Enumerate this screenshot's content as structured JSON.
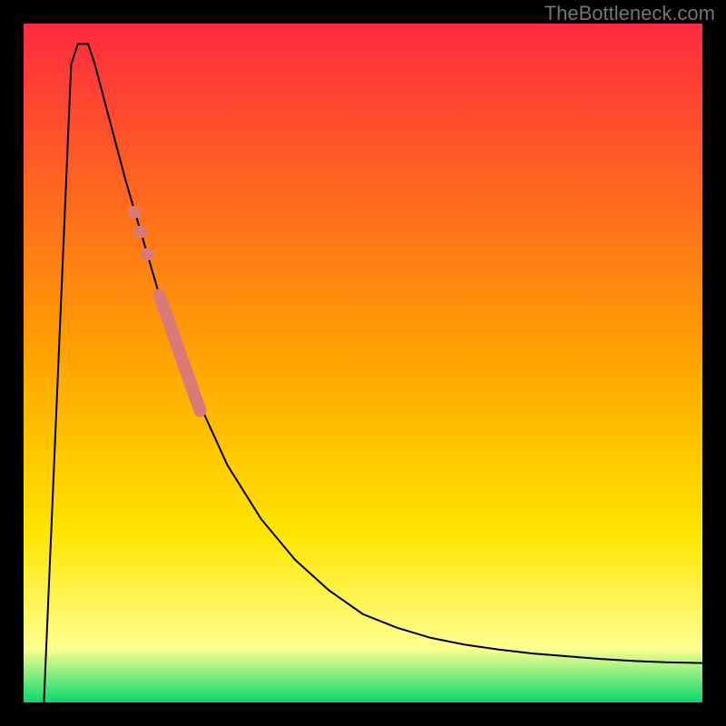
{
  "watermark": "TheBottleneck.com",
  "chart_data": {
    "type": "line",
    "title": "",
    "xlabel": "",
    "ylabel": "",
    "xlim": [
      0,
      100
    ],
    "ylim": [
      0,
      100
    ],
    "background_gradient": {
      "stops": [
        {
          "y": 0,
          "color": "#FF2A3F"
        },
        {
          "y": 50,
          "color": "#FFA500"
        },
        {
          "y": 75,
          "color": "#FFE500"
        },
        {
          "y": 92,
          "color": "#FFFF90"
        },
        {
          "y": 100,
          "color": "#08D870"
        }
      ]
    },
    "series": [
      {
        "name": "curve",
        "type": "line",
        "color": "#000000",
        "width": 2,
        "points": [
          {
            "x": 3.0,
            "y": 0.0
          },
          {
            "x": 7.0,
            "y": 94.0
          },
          {
            "x": 8.0,
            "y": 97.0
          },
          {
            "x": 9.5,
            "y": 97.0
          },
          {
            "x": 10.5,
            "y": 94.0
          },
          {
            "x": 15.0,
            "y": 77.0
          },
          {
            "x": 20.0,
            "y": 60.0
          },
          {
            "x": 25.0,
            "y": 46.0
          },
          {
            "x": 30.0,
            "y": 35.0
          },
          {
            "x": 35.0,
            "y": 27.0
          },
          {
            "x": 40.0,
            "y": 21.0
          },
          {
            "x": 45.0,
            "y": 16.5
          },
          {
            "x": 50.0,
            "y": 13.0
          },
          {
            "x": 55.0,
            "y": 11.0
          },
          {
            "x": 60.0,
            "y": 9.5
          },
          {
            "x": 65.0,
            "y": 8.5
          },
          {
            "x": 70.0,
            "y": 7.8
          },
          {
            "x": 75.0,
            "y": 7.2
          },
          {
            "x": 80.0,
            "y": 6.8
          },
          {
            "x": 85.0,
            "y": 6.4
          },
          {
            "x": 90.0,
            "y": 6.1
          },
          {
            "x": 95.0,
            "y": 5.9
          },
          {
            "x": 100.0,
            "y": 5.8
          }
        ]
      },
      {
        "name": "highlight-segment",
        "type": "line",
        "color": "#D97A79",
        "width": 14,
        "cap": "round",
        "points": [
          {
            "x": 20.0,
            "y": 60.0
          },
          {
            "x": 26.0,
            "y": 43.0
          }
        ]
      },
      {
        "name": "highlight-dots",
        "type": "scatter",
        "color": "#D97A79",
        "size": 14,
        "points": [
          {
            "x": 18.2,
            "y": 66.0
          },
          {
            "x": 17.2,
            "y": 69.3
          },
          {
            "x": 16.3,
            "y": 72.2
          }
        ]
      }
    ],
    "frame": {
      "color": "#000000",
      "width": 26
    }
  }
}
